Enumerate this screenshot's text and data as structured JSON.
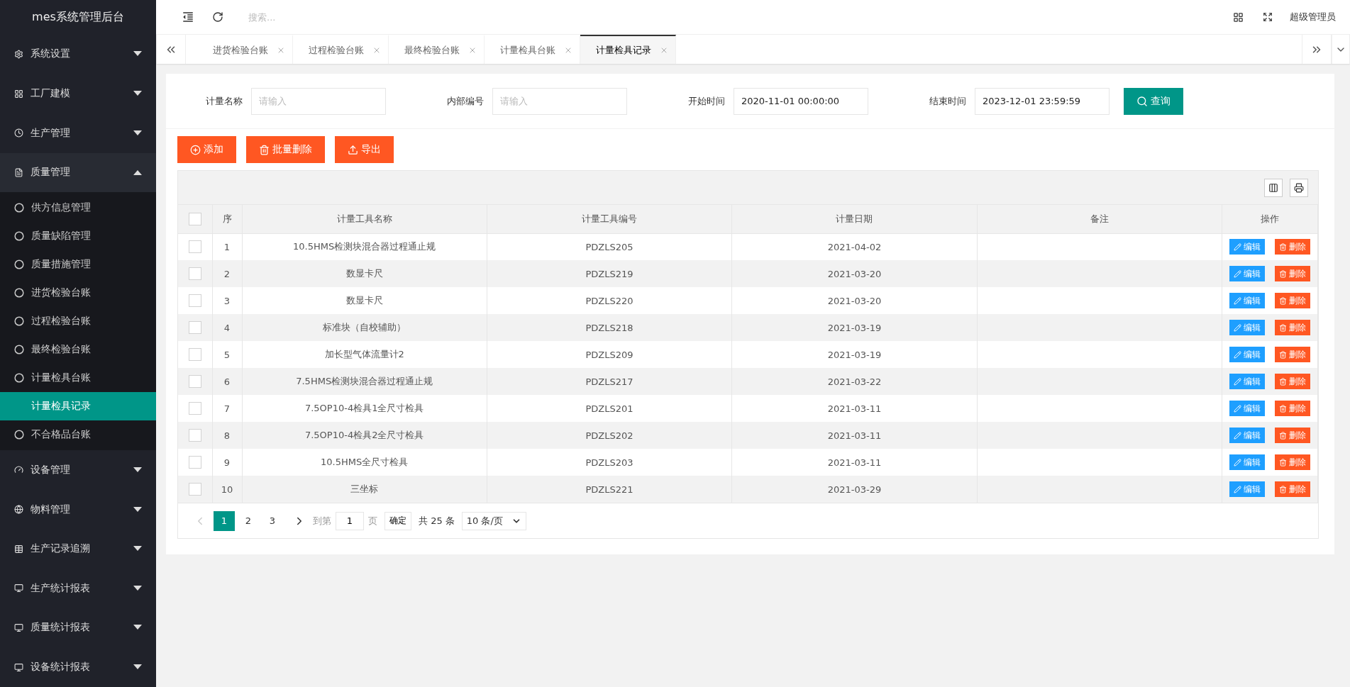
{
  "sidebar": {
    "title": "mes系统管理后台",
    "items": [
      {
        "label": "系统设置",
        "expanded": false
      },
      {
        "label": "工厂建模",
        "expanded": false
      },
      {
        "label": "生产管理",
        "expanded": false
      },
      {
        "label": "质量管理",
        "expanded": true,
        "children": [
          {
            "label": "供方信息管理",
            "selected": false
          },
          {
            "label": "质量缺陷管理",
            "selected": false
          },
          {
            "label": "质量措施管理",
            "selected": false
          },
          {
            "label": "进货检验台账",
            "selected": false
          },
          {
            "label": "过程检验台账",
            "selected": false
          },
          {
            "label": "最终检验台账",
            "selected": false
          },
          {
            "label": "计量检具台账",
            "selected": false
          },
          {
            "label": "计量检具记录",
            "selected": true
          },
          {
            "label": "不合格品台账",
            "selected": false
          }
        ]
      },
      {
        "label": "设备管理",
        "expanded": false
      },
      {
        "label": "物料管理",
        "expanded": false
      },
      {
        "label": "生产记录追溯",
        "expanded": false
      },
      {
        "label": "生产统计报表",
        "expanded": false
      },
      {
        "label": "质量统计报表",
        "expanded": false
      },
      {
        "label": "设备统计报表",
        "expanded": false
      }
    ]
  },
  "search": {
    "placeholder": "搜索..."
  },
  "user": "超级管理员",
  "tabs": [
    {
      "label": "进货检验台账",
      "selected": false
    },
    {
      "label": "过程检验台账",
      "selected": false
    },
    {
      "label": "最终检验台账",
      "selected": false
    },
    {
      "label": "计量检具台账",
      "selected": false
    },
    {
      "label": "计量检具记录",
      "selected": true
    }
  ],
  "filters": [
    {
      "label": "计量名称",
      "placeholder": "请输入"
    },
    {
      "label": "内部编号",
      "placeholder": "请输入"
    },
    {
      "label": "开始时间",
      "value": "2020-11-01 00:00:00"
    },
    {
      "label": "结束时间",
      "value": "2023-12-01 23:59:59"
    }
  ],
  "query_button": "查询",
  "actions": [
    {
      "kind": "add",
      "label": "添加"
    },
    {
      "kind": "delete",
      "label": "批量删除"
    },
    {
      "kind": "export",
      "label": "导出"
    }
  ],
  "table": {
    "header_checked": false,
    "columns": [
      "序",
      "计量工具名称",
      "计量工具编号",
      "计量日期",
      "备注",
      "操作"
    ],
    "rows": [
      {
        "checked": false,
        "no": "1",
        "name": "10.5HMS检测块混合器过程通止规",
        "code": "PDZLS205",
        "date": "2021-04-02",
        "edit": "编辑",
        "delete": "删除"
      },
      {
        "checked": false,
        "no": "2",
        "name": "数显卡尺",
        "code": "PDZLS219",
        "date": "2021-03-20",
        "edit": "编辑",
        "delete": "删除"
      },
      {
        "checked": false,
        "no": "3",
        "name": "数显卡尺",
        "code": "PDZLS220",
        "date": "2021-03-20",
        "edit": "编辑",
        "delete": "删除"
      },
      {
        "checked": false,
        "no": "4",
        "name": "标准块（自校辅助）",
        "code": "PDZLS218",
        "date": "2021-03-19",
        "edit": "编辑",
        "delete": "删除"
      },
      {
        "checked": false,
        "no": "5",
        "name": "加长型气体流量计2",
        "code": "PDZLS209",
        "date": "2021-03-19",
        "edit": "编辑",
        "delete": "删除"
      },
      {
        "checked": false,
        "no": "6",
        "name": "7.5HMS检测块混合器过程通止规",
        "code": "PDZLS217",
        "date": "2021-03-22",
        "edit": "编辑",
        "delete": "删除"
      },
      {
        "checked": false,
        "no": "7",
        "name": "7.5OP10-4检具1全尺寸检具",
        "code": "PDZLS201",
        "date": "2021-03-11",
        "edit": "编辑",
        "delete": "删除"
      },
      {
        "checked": false,
        "no": "8",
        "name": "7.5OP10-4检具2全尺寸检具",
        "code": "PDZLS202",
        "date": "2021-03-11",
        "edit": "编辑",
        "delete": "删除"
      },
      {
        "checked": false,
        "no": "9",
        "name": "10.5HMS全尺寸检具",
        "code": "PDZLS203",
        "date": "2021-03-11",
        "edit": "编辑",
        "delete": "删除"
      },
      {
        "checked": false,
        "no": "10",
        "name": "三坐标",
        "code": "PDZLS221",
        "date": "2021-03-29",
        "edit": "编辑",
        "delete": "删除"
      }
    ]
  },
  "pagination": {
    "pages": [
      {
        "label": "1",
        "selected": true
      },
      {
        "label": "2",
        "selected": false
      },
      {
        "label": "3",
        "selected": false
      }
    ],
    "goto_label": "到第",
    "goto_value": "1",
    "page_unit": "页",
    "confirm": "确定",
    "total": "共 25 条",
    "page_size": "10 条/页"
  }
}
